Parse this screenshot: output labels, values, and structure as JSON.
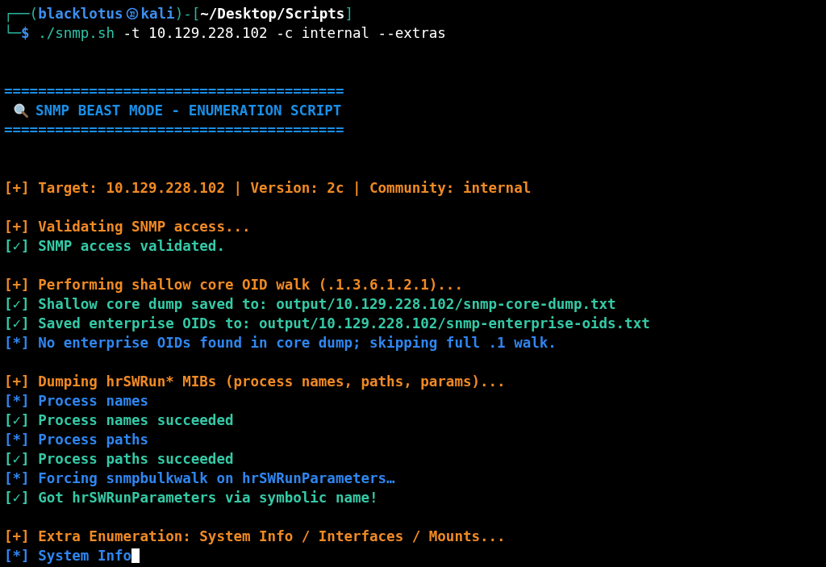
{
  "prompt": {
    "lines": [
      {
        "segments": [
          {
            "kind": "frame",
            "text": "┌──("
          },
          {
            "kind": "user",
            "text": "blacklotus"
          },
          {
            "kind": "symbol"
          },
          {
            "kind": "user",
            "text": "kali"
          },
          {
            "kind": "frame",
            "text": ")-["
          },
          {
            "kind": "path",
            "text": "~/Desktop/Scripts"
          },
          {
            "kind": "frame",
            "text": "]"
          }
        ]
      },
      {
        "segments": [
          {
            "kind": "frame",
            "text": "└─"
          },
          {
            "kind": "sigil",
            "text": "$"
          },
          {
            "kind": "program",
            "text": "./snmp.sh"
          },
          {
            "kind": "args",
            "text": "-t 10.129.228.102 -c internal --extras"
          }
        ]
      }
    ]
  },
  "banner": {
    "top_rule": "========================================",
    "title": "SNMP BEAST MODE - ENUMERATION SCRIPT",
    "bottom_rule": "========================================"
  },
  "blocks": [
    {
      "lines": [
        {
          "kind": "plus",
          "text": "[+] Target: 10.129.228.102 | Version: 2c | Community: internal"
        }
      ]
    },
    {
      "lines": [
        {
          "kind": "plus",
          "text": "[+] Validating SNMP access..."
        },
        {
          "kind": "ok",
          "text": "[✓] SNMP access validated."
        }
      ]
    },
    {
      "lines": [
        {
          "kind": "plus",
          "text": "[+] Performing shallow core OID walk (.1.3.6.1.2.1)..."
        },
        {
          "kind": "ok",
          "text": "[✓] Shallow core dump saved to: output/10.129.228.102/snmp-core-dump.txt"
        },
        {
          "kind": "ok",
          "text": "[✓] Saved enterprise OIDs to: output/10.129.228.102/snmp-enterprise-oids.txt"
        },
        {
          "kind": "star",
          "text": "[*] No enterprise OIDs found in core dump; skipping full .1 walk."
        }
      ]
    },
    {
      "lines": [
        {
          "kind": "plus",
          "text": "[+] Dumping hrSWRun* MIBs (process names, paths, params)..."
        },
        {
          "kind": "star",
          "text": "[*] Process names"
        },
        {
          "kind": "ok",
          "text": "[✓] Process names succeeded"
        },
        {
          "kind": "star",
          "text": "[*] Process paths"
        },
        {
          "kind": "ok",
          "text": "[✓] Process paths succeeded"
        },
        {
          "kind": "star",
          "text": "[*] Forcing snmpbulkwalk on hrSWRunParameters…"
        },
        {
          "kind": "ok",
          "text": "[✓] Got hrSWRunParameters via symbolic name!"
        }
      ]
    },
    {
      "lines": [
        {
          "kind": "plus",
          "text": "[+] Extra Enumeration: System Info / Interfaces / Mounts..."
        },
        {
          "kind": "star",
          "text": "[*] System Info",
          "cursor": true
        }
      ]
    }
  ]
}
